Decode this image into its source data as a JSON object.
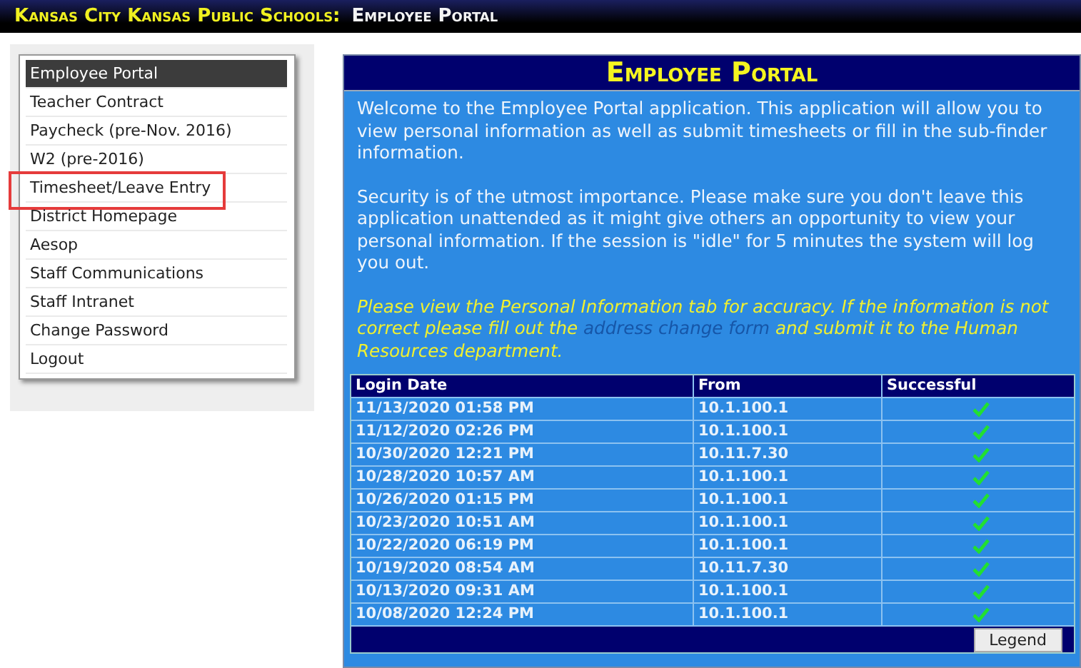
{
  "header": {
    "org": "Kansas City Kansas Public Schools:",
    "app": "Employee Portal"
  },
  "menu": [
    {
      "label": "Employee Portal",
      "selected": true,
      "highlighted": false
    },
    {
      "label": "Teacher Contract",
      "selected": false,
      "highlighted": false
    },
    {
      "label": "Paycheck (pre-Nov. 2016)",
      "selected": false,
      "highlighted": false
    },
    {
      "label": "W2 (pre-2016)",
      "selected": false,
      "highlighted": false
    },
    {
      "label": "Timesheet/Leave Entry",
      "selected": false,
      "highlighted": true
    },
    {
      "label": "District Homepage",
      "selected": false,
      "highlighted": false
    },
    {
      "label": "Aesop",
      "selected": false,
      "highlighted": false
    },
    {
      "label": "Staff Communications",
      "selected": false,
      "highlighted": false
    },
    {
      "label": "Staff Intranet",
      "selected": false,
      "highlighted": false
    },
    {
      "label": "Change Password",
      "selected": false,
      "highlighted": false
    },
    {
      "label": "Logout",
      "selected": false,
      "highlighted": false
    }
  ],
  "panel": {
    "title": "Employee Portal",
    "paragraphs": [
      "Welcome to the Employee Portal application. This application will allow you to view personal information as well as submit timesheets or fill in the sub-finder information.",
      "Security is of the utmost importance. Please make sure you don't leave this application unattended as it might give others an opportunity to view your personal information. If the session is \"idle\" for 5 minutes the system will log you out."
    ],
    "notice": {
      "before": "Please view the Personal Information tab for accuracy. If the information is not correct please fill out the",
      "link": "address change form",
      "after": "and submit it to the Human Resources department."
    }
  },
  "table": {
    "columns": [
      "Login Date",
      "From",
      "Successful"
    ],
    "rows": [
      {
        "date": "11/13/2020 01:58 PM",
        "from": "10.1.100.1",
        "successful": true
      },
      {
        "date": "11/12/2020 02:26 PM",
        "from": "10.1.100.1",
        "successful": true
      },
      {
        "date": "10/30/2020 12:21 PM",
        "from": "10.11.7.30",
        "successful": true
      },
      {
        "date": "10/28/2020 10:57 AM",
        "from": "10.1.100.1",
        "successful": true
      },
      {
        "date": "10/26/2020 01:15 PM",
        "from": "10.1.100.1",
        "successful": true
      },
      {
        "date": "10/23/2020 10:51 AM",
        "from": "10.1.100.1",
        "successful": true
      },
      {
        "date": "10/22/2020 06:19 PM",
        "from": "10.1.100.1",
        "successful": true
      },
      {
        "date": "10/19/2020 08:54 AM",
        "from": "10.11.7.30",
        "successful": true
      },
      {
        "date": "10/13/2020 09:31 AM",
        "from": "10.1.100.1",
        "successful": true
      },
      {
        "date": "10/08/2020 12:24 PM",
        "from": "10.1.100.1",
        "successful": true
      }
    ],
    "button": "Legend"
  }
}
